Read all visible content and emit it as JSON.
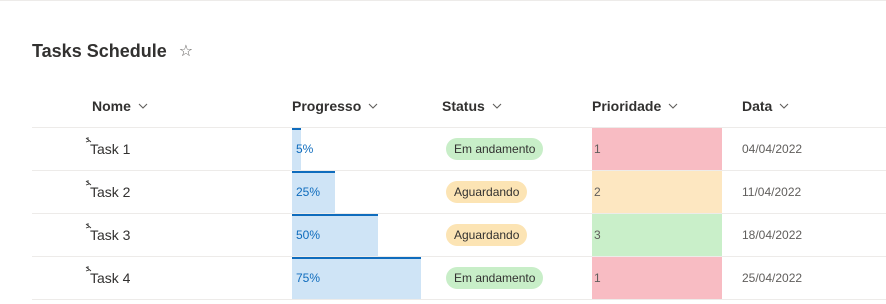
{
  "page": {
    "title": "Tasks Schedule",
    "favorite_icon": "star-outline-icon"
  },
  "columns": {
    "name": "Nome",
    "progress": "Progresso",
    "status": "Status",
    "priority": "Prioridade",
    "date": "Data"
  },
  "colors": {
    "accent": "#0f6cbd",
    "progress_fill": "#cfe4f6",
    "status_em_andamento": "#c8eec8",
    "status_aguardando": "#fce4b4",
    "priority_1": "#f8bcc3",
    "priority_2": "#fde7c1",
    "priority_3": "#c9efc9"
  },
  "rows": [
    {
      "name": "Task 1",
      "progress": "5%",
      "progress_value": 0.05,
      "status": "Em andamento",
      "priority": "1",
      "date": "04/04/2022"
    },
    {
      "name": "Task 2",
      "progress": "25%",
      "progress_value": 0.25,
      "status": "Aguardando",
      "priority": "2",
      "date": "11/04/2022"
    },
    {
      "name": "Task 3",
      "progress": "50%",
      "progress_value": 0.5,
      "status": "Aguardando",
      "priority": "3",
      "date": "18/04/2022"
    },
    {
      "name": "Task 4",
      "progress": "75%",
      "progress_value": 0.75,
      "status": "Em andamento",
      "priority": "1",
      "date": "25/04/2022"
    }
  ]
}
